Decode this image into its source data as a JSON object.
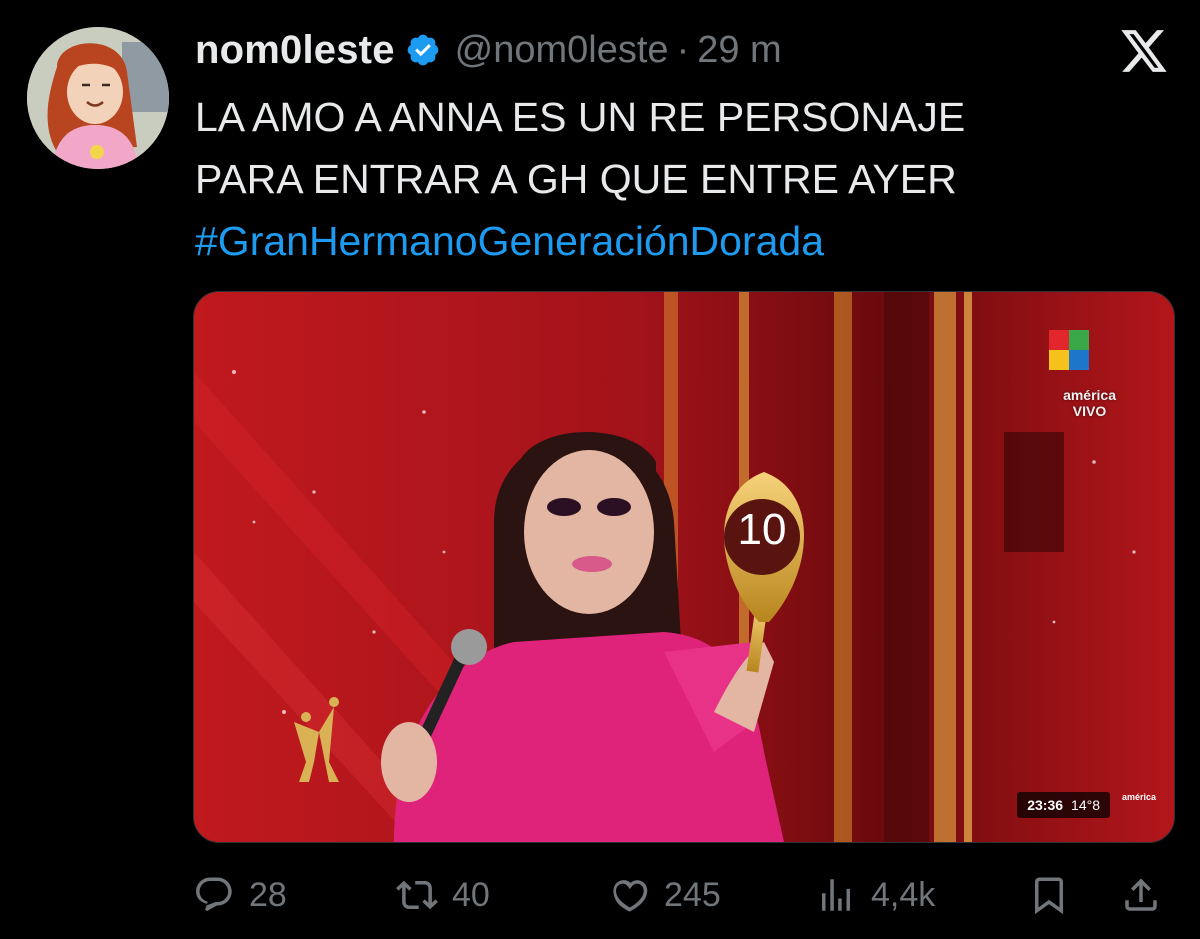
{
  "tweet": {
    "display_name": "nom0leste",
    "handle": "@nom0leste",
    "separator": "·",
    "time": "29 m",
    "text_line_1": "LA AMO A ANNA ES UN RE PERSONAJE",
    "text_line_2": "PARA ENTRAR A GH QUE ENTRE AYER",
    "hashtag": "#GranHermanoGeneraciónDorada"
  },
  "media": {
    "channel_label_1": "américa",
    "channel_label_2": "VIVO",
    "paddle_score": "10",
    "clock": "23:36",
    "temperature": "14°8",
    "channel_small": "américa"
  },
  "actions": {
    "replies": "28",
    "retweets": "40",
    "likes": "245",
    "views": "4,4k"
  },
  "colors": {
    "background": "#000000",
    "accent": "#1d9bf0",
    "text": "#e7e9ea",
    "muted": "#71767b"
  },
  "icons": [
    "verified-badge-icon",
    "x-logo-icon",
    "reply-icon",
    "retweet-icon",
    "like-icon",
    "views-icon",
    "bookmark-icon",
    "share-icon"
  ]
}
